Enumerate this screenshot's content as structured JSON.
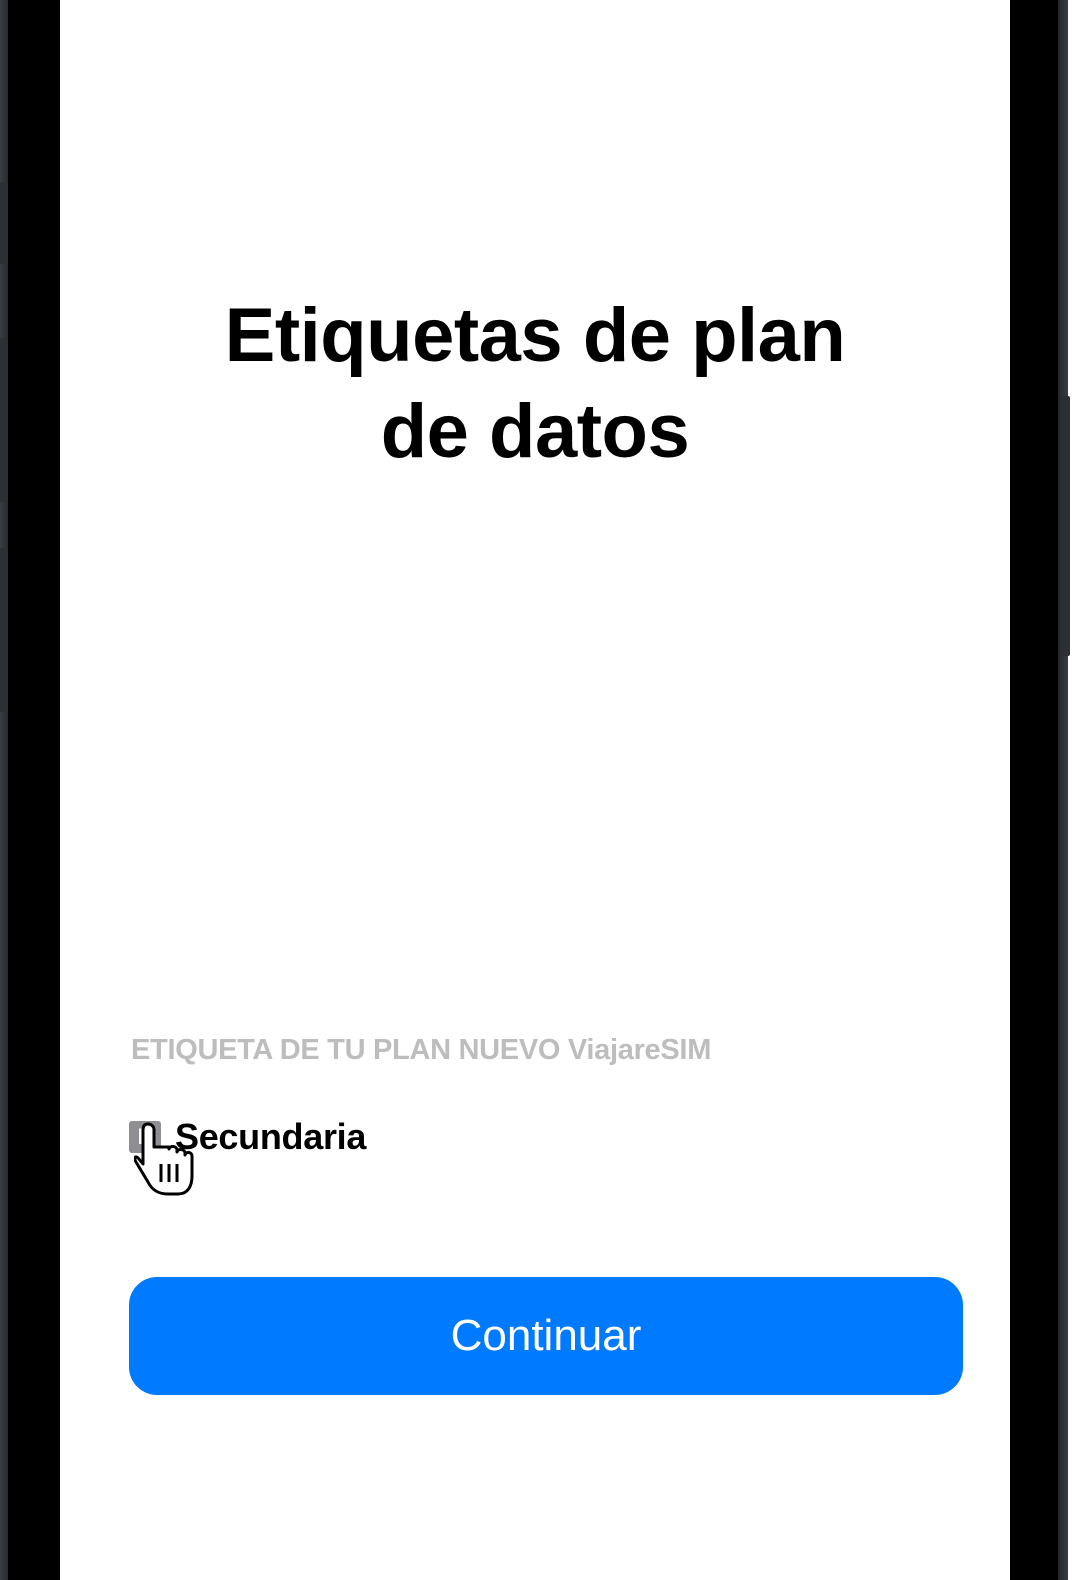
{
  "screen": {
    "title_line1": "Etiquetas de plan",
    "title_line2": "de datos",
    "section_label": "ETIQUETA DE TU PLAN NUEVO ViajareSIM",
    "plan": {
      "badge_letter": "P",
      "name": "Secundaria"
    },
    "continue_label": "Continuar"
  },
  "colors": {
    "accent": "#007aff",
    "label_gray": "#bdbdbd",
    "badge_gray": "#8e8e93"
  }
}
